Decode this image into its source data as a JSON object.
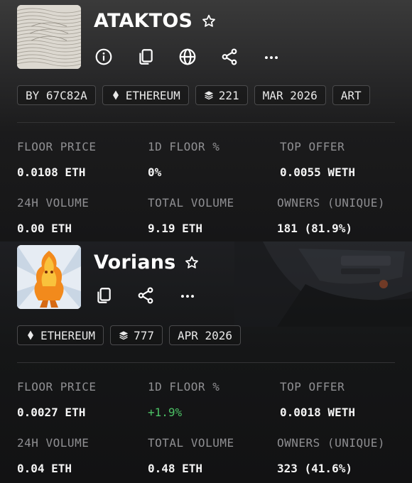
{
  "collections": [
    {
      "name": "ATAKTOS",
      "actions": [
        "info-icon",
        "copy-icon",
        "globe-icon",
        "share-icon",
        "more-icon"
      ],
      "chips": {
        "creator": "BY 67C82A",
        "chain": "ETHEREUM",
        "items": "221",
        "date": "MAR 2026",
        "category": "ART"
      },
      "stats": {
        "floor_price_label": "FLOOR PRICE",
        "floor_price": "0.0108 ETH",
        "floor_change_label": "1D FLOOR %",
        "floor_change": "0%",
        "top_offer_label": "TOP OFFER",
        "top_offer": "0.0055 WETH",
        "volume_24h_label": "24H VOLUME",
        "volume_24h": "0.00 ETH",
        "total_volume_label": "TOTAL VOLUME",
        "total_volume": "9.19 ETH",
        "owners_label": "OWNERS (UNIQUE)",
        "owners": "181 (81.9%)"
      }
    },
    {
      "name": "Vorians",
      "actions": [
        "copy-icon",
        "share-icon",
        "more-icon"
      ],
      "chips": {
        "chain": "ETHEREUM",
        "items": "777",
        "date": "APR 2026"
      },
      "stats": {
        "floor_price_label": "FLOOR PRICE",
        "floor_price": "0.0027 ETH",
        "floor_change_label": "1D FLOOR %",
        "floor_change": "+1.9%",
        "top_offer_label": "TOP OFFER",
        "top_offer": "0.0018 WETH",
        "volume_24h_label": "24H VOLUME",
        "volume_24h": "0.04 ETH",
        "total_volume_label": "TOTAL VOLUME",
        "total_volume": "0.48 ETH",
        "owners_label": "OWNERS (UNIQUE)",
        "owners": "323 (41.6%)"
      }
    }
  ],
  "colors": {
    "positive": "#4cc065",
    "label": "#8f8f92",
    "chip_border": "#4a4a4c"
  }
}
